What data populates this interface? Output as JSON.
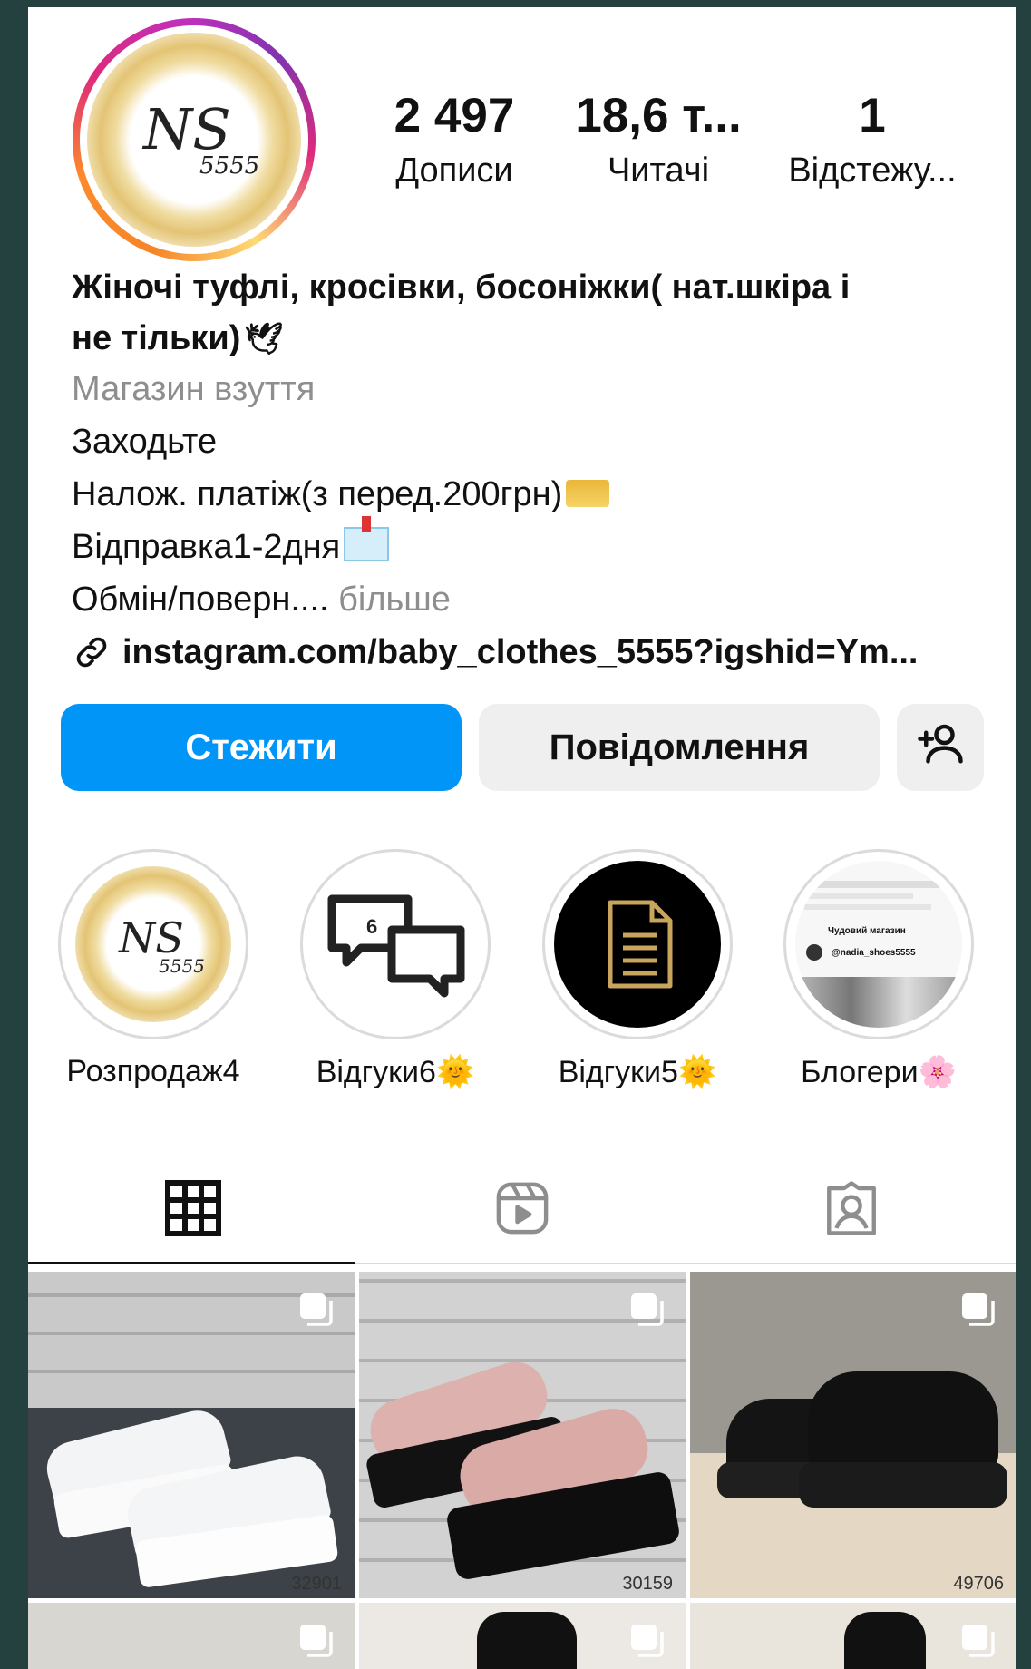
{
  "profile": {
    "logo_text": "NS",
    "logo_sub": "5555",
    "stats": [
      {
        "value": "2 497",
        "label": "Дописи"
      },
      {
        "value": "18,6 т...",
        "label": "Читачі"
      },
      {
        "value": "1",
        "label": "Відстежу..."
      }
    ],
    "name_line1": "Жіночі туфлі, кросівки, босоніжки( нат.шкіра і",
    "name_line2": "не тільки)",
    "category": "Магазин взуття",
    "bio_lines": [
      "Заходьте",
      "Налож. платіж(з перед.200грн)",
      "Відправка1-2дня",
      "Обмін/поверн...."
    ],
    "more_label": "більше",
    "link": "instagram.com/baby_clothes_5555?igshid=Ym..."
  },
  "actions": {
    "follow": "Стежити",
    "message": "Повідомлення"
  },
  "highlights": [
    {
      "label": "Розпродаж4"
    },
    {
      "label": "Відгуки6",
      "badge": "6"
    },
    {
      "label": "Відгуки5"
    },
    {
      "label": "Блогери"
    }
  ],
  "blogger_preview": {
    "title": "Чудовий магазин",
    "handle": "@nadia_shoes5555"
  },
  "tabs": [
    "grid-tab",
    "reels-tab",
    "tagged-tab"
  ],
  "posts": [
    {
      "code": "32901"
    },
    {
      "code": "30159"
    },
    {
      "code": "49706"
    }
  ],
  "colors": {
    "follow_bg": "#0095f6",
    "secondary_bg": "#efefef",
    "page_bg": "#24403f"
  }
}
